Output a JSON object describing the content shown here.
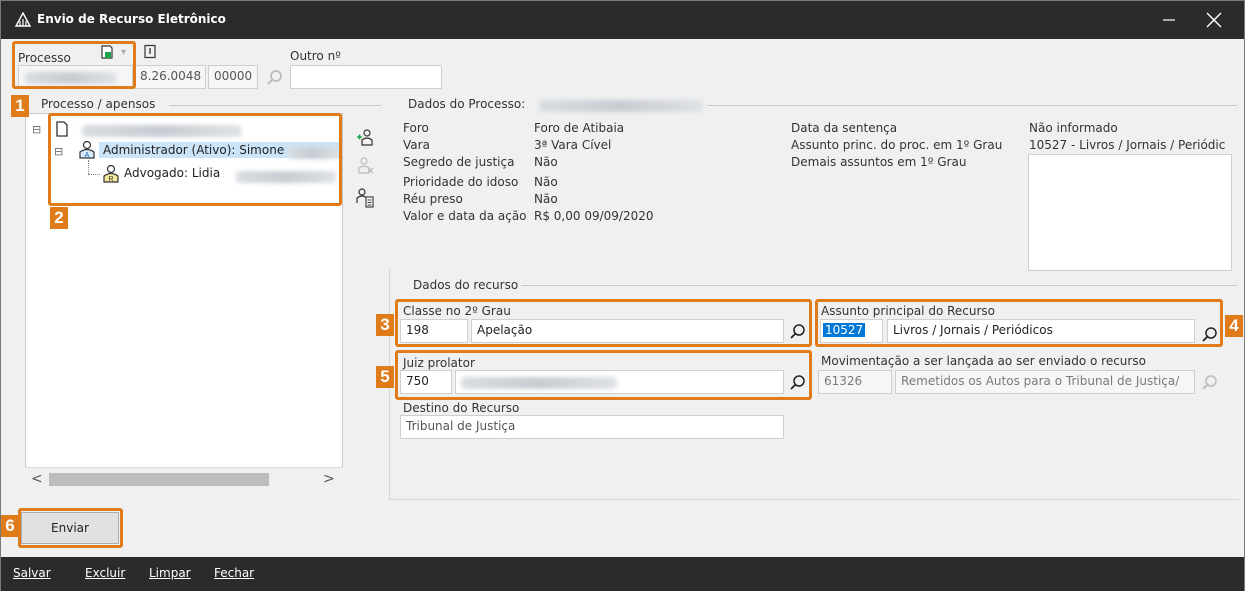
{
  "window": {
    "title": "Envio de Recurso Eletrônico"
  },
  "processo": {
    "label": "Processo",
    "segment2": "8.26.0048",
    "segment3": "00000",
    "outro_label": "Outro nº",
    "outro_value": ""
  },
  "tree": {
    "group_label": "Processo / apensos",
    "items": [
      {
        "label": ""
      },
      {
        "label": "Administrador (Ativo): Simone"
      },
      {
        "label": "Advogado: Lidia"
      }
    ]
  },
  "dados_processo": {
    "group_label": "Dados do Processo:",
    "fields": [
      {
        "label": "Foro",
        "value": "Foro de Atibaia"
      },
      {
        "label": "Vara",
        "value": "3ª Vara Cível"
      },
      {
        "label": "Segredo de justiça",
        "value": "Não"
      },
      {
        "label": "Prioridade do idoso",
        "value": "Não"
      },
      {
        "label": "Réu preso",
        "value": "Não"
      },
      {
        "label": "Valor e data da ação",
        "value": "R$ 0,00 09/09/2020"
      }
    ],
    "right_labels": [
      "Data da sentença",
      "Assunto princ. do proc. em 1º Grau",
      "Demais assuntos em 1º Grau"
    ],
    "right_values": [
      "Não informado",
      "10527 - Livros / Jornais / Periódic"
    ]
  },
  "dados_recurso": {
    "group_label": "Dados do recurso",
    "classe": {
      "label": "Classe no 2º Grau",
      "code": "198",
      "desc": "Apelação"
    },
    "assunto": {
      "label": "Assunto principal do Recurso",
      "code": "10527",
      "desc": "Livros / Jornais / Periódicos"
    },
    "juiz": {
      "label": "Juiz prolator",
      "code": "750",
      "desc": ""
    },
    "movimentacao": {
      "label": "Movimentação a ser lançada ao ser enviado o recurso",
      "code": "61326",
      "desc": "Remetidos os Autos para o Tribunal de Justiça/"
    },
    "destino": {
      "label": "Destino do Recurso",
      "value": "Tribunal de Justiça"
    }
  },
  "badges": [
    "1",
    "2",
    "3",
    "4",
    "5",
    "6"
  ],
  "buttons": {
    "enviar": "Enviar"
  },
  "menu": {
    "salvar": "Salvar",
    "excluir": "Excluir",
    "limpar": "Limpar",
    "fechar": "Fechar"
  },
  "colors": {
    "highlight": "#e07b1a",
    "titlebar": "#2b2b2b",
    "selection": "#cce4f7"
  }
}
